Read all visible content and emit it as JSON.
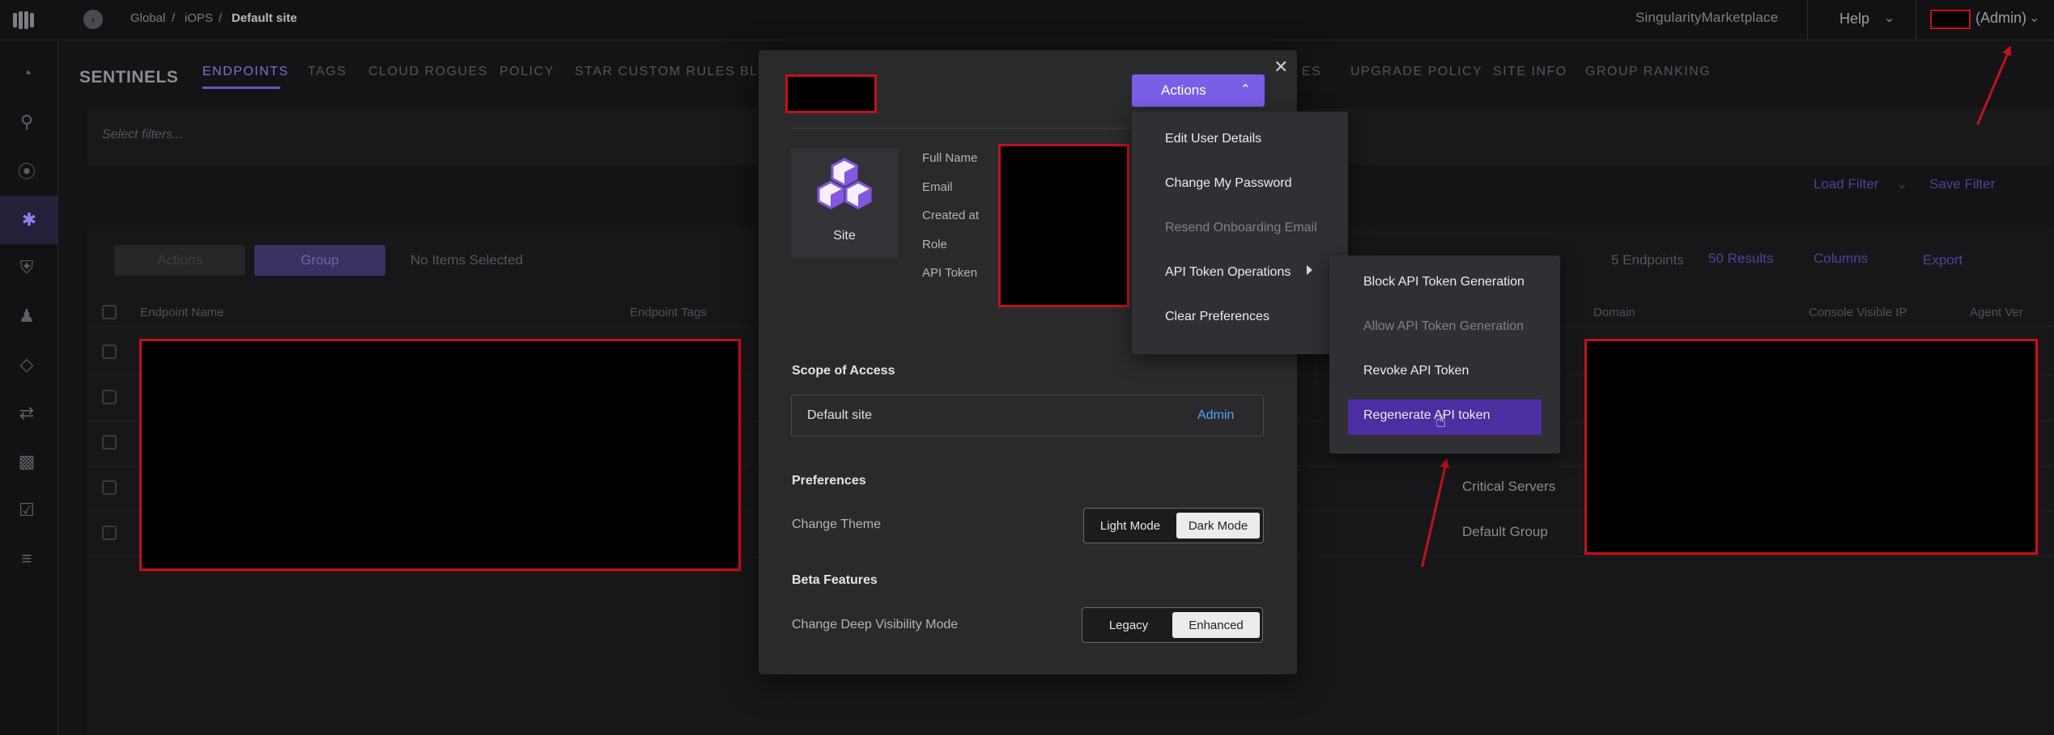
{
  "topbar": {
    "breadcrumb": [
      "Global",
      "/",
      "iOPS",
      "/",
      "Default site"
    ],
    "marketplace": "SingularityMarketplace",
    "help": "Help",
    "user_role": "(Admin)"
  },
  "sentinels": {
    "title": "SENTINELS",
    "tabs": [
      "ENDPOINTS",
      "TAGS",
      "CLOUD ROGUES",
      "POLICY",
      "STAR CUSTOM RULES",
      "BL",
      "ES",
      "UPGRADE POLICY",
      "SITE INFO",
      "GROUP RANKING"
    ],
    "filter_placeholder": "Select filters...",
    "load_filter": "Load Filter",
    "save_filter": "Save Filter",
    "actions": "Actions",
    "group": "Group",
    "no_items": "No Items Selected",
    "endpoints_count": "5 Endpoints",
    "results": "50 Results",
    "columns": "Columns",
    "export": "Export",
    "headers": [
      "Endpoint Name",
      "Endpoint Tags",
      "Domain",
      "Console Visible IP",
      "Agent Ver"
    ],
    "groups": [
      "Critical Servers",
      "Default Group"
    ]
  },
  "modal": {
    "site_label": "Site",
    "fields": [
      "Full Name",
      "Email",
      "Created at",
      "Role",
      "API Token"
    ],
    "actions_label": "Actions",
    "scope_title": "Scope of Access",
    "scope_site": "Default site",
    "scope_role": "Admin",
    "preferences_title": "Preferences",
    "theme_label": "Change Theme",
    "theme_options": [
      "Light Mode",
      "Dark Mode"
    ],
    "beta_title": "Beta Features",
    "visibility_label": "Change Deep Visibility Mode",
    "visibility_options": [
      "Legacy",
      "Enhanced"
    ]
  },
  "actions_menu": {
    "items": [
      "Edit User Details",
      "Change My Password",
      "Resend Onboarding Email",
      "API Token Operations",
      "Clear Preferences"
    ]
  },
  "api_submenu": {
    "items": [
      "Block API Token Generation",
      "Allow API Token Generation",
      "Revoke API Token",
      "Regenerate API token"
    ]
  },
  "colors": {
    "accent": "#7a5ee6",
    "highlight": "#4b2ea0",
    "redaction_border": "#c0121b",
    "link": "#4ea3ff"
  }
}
